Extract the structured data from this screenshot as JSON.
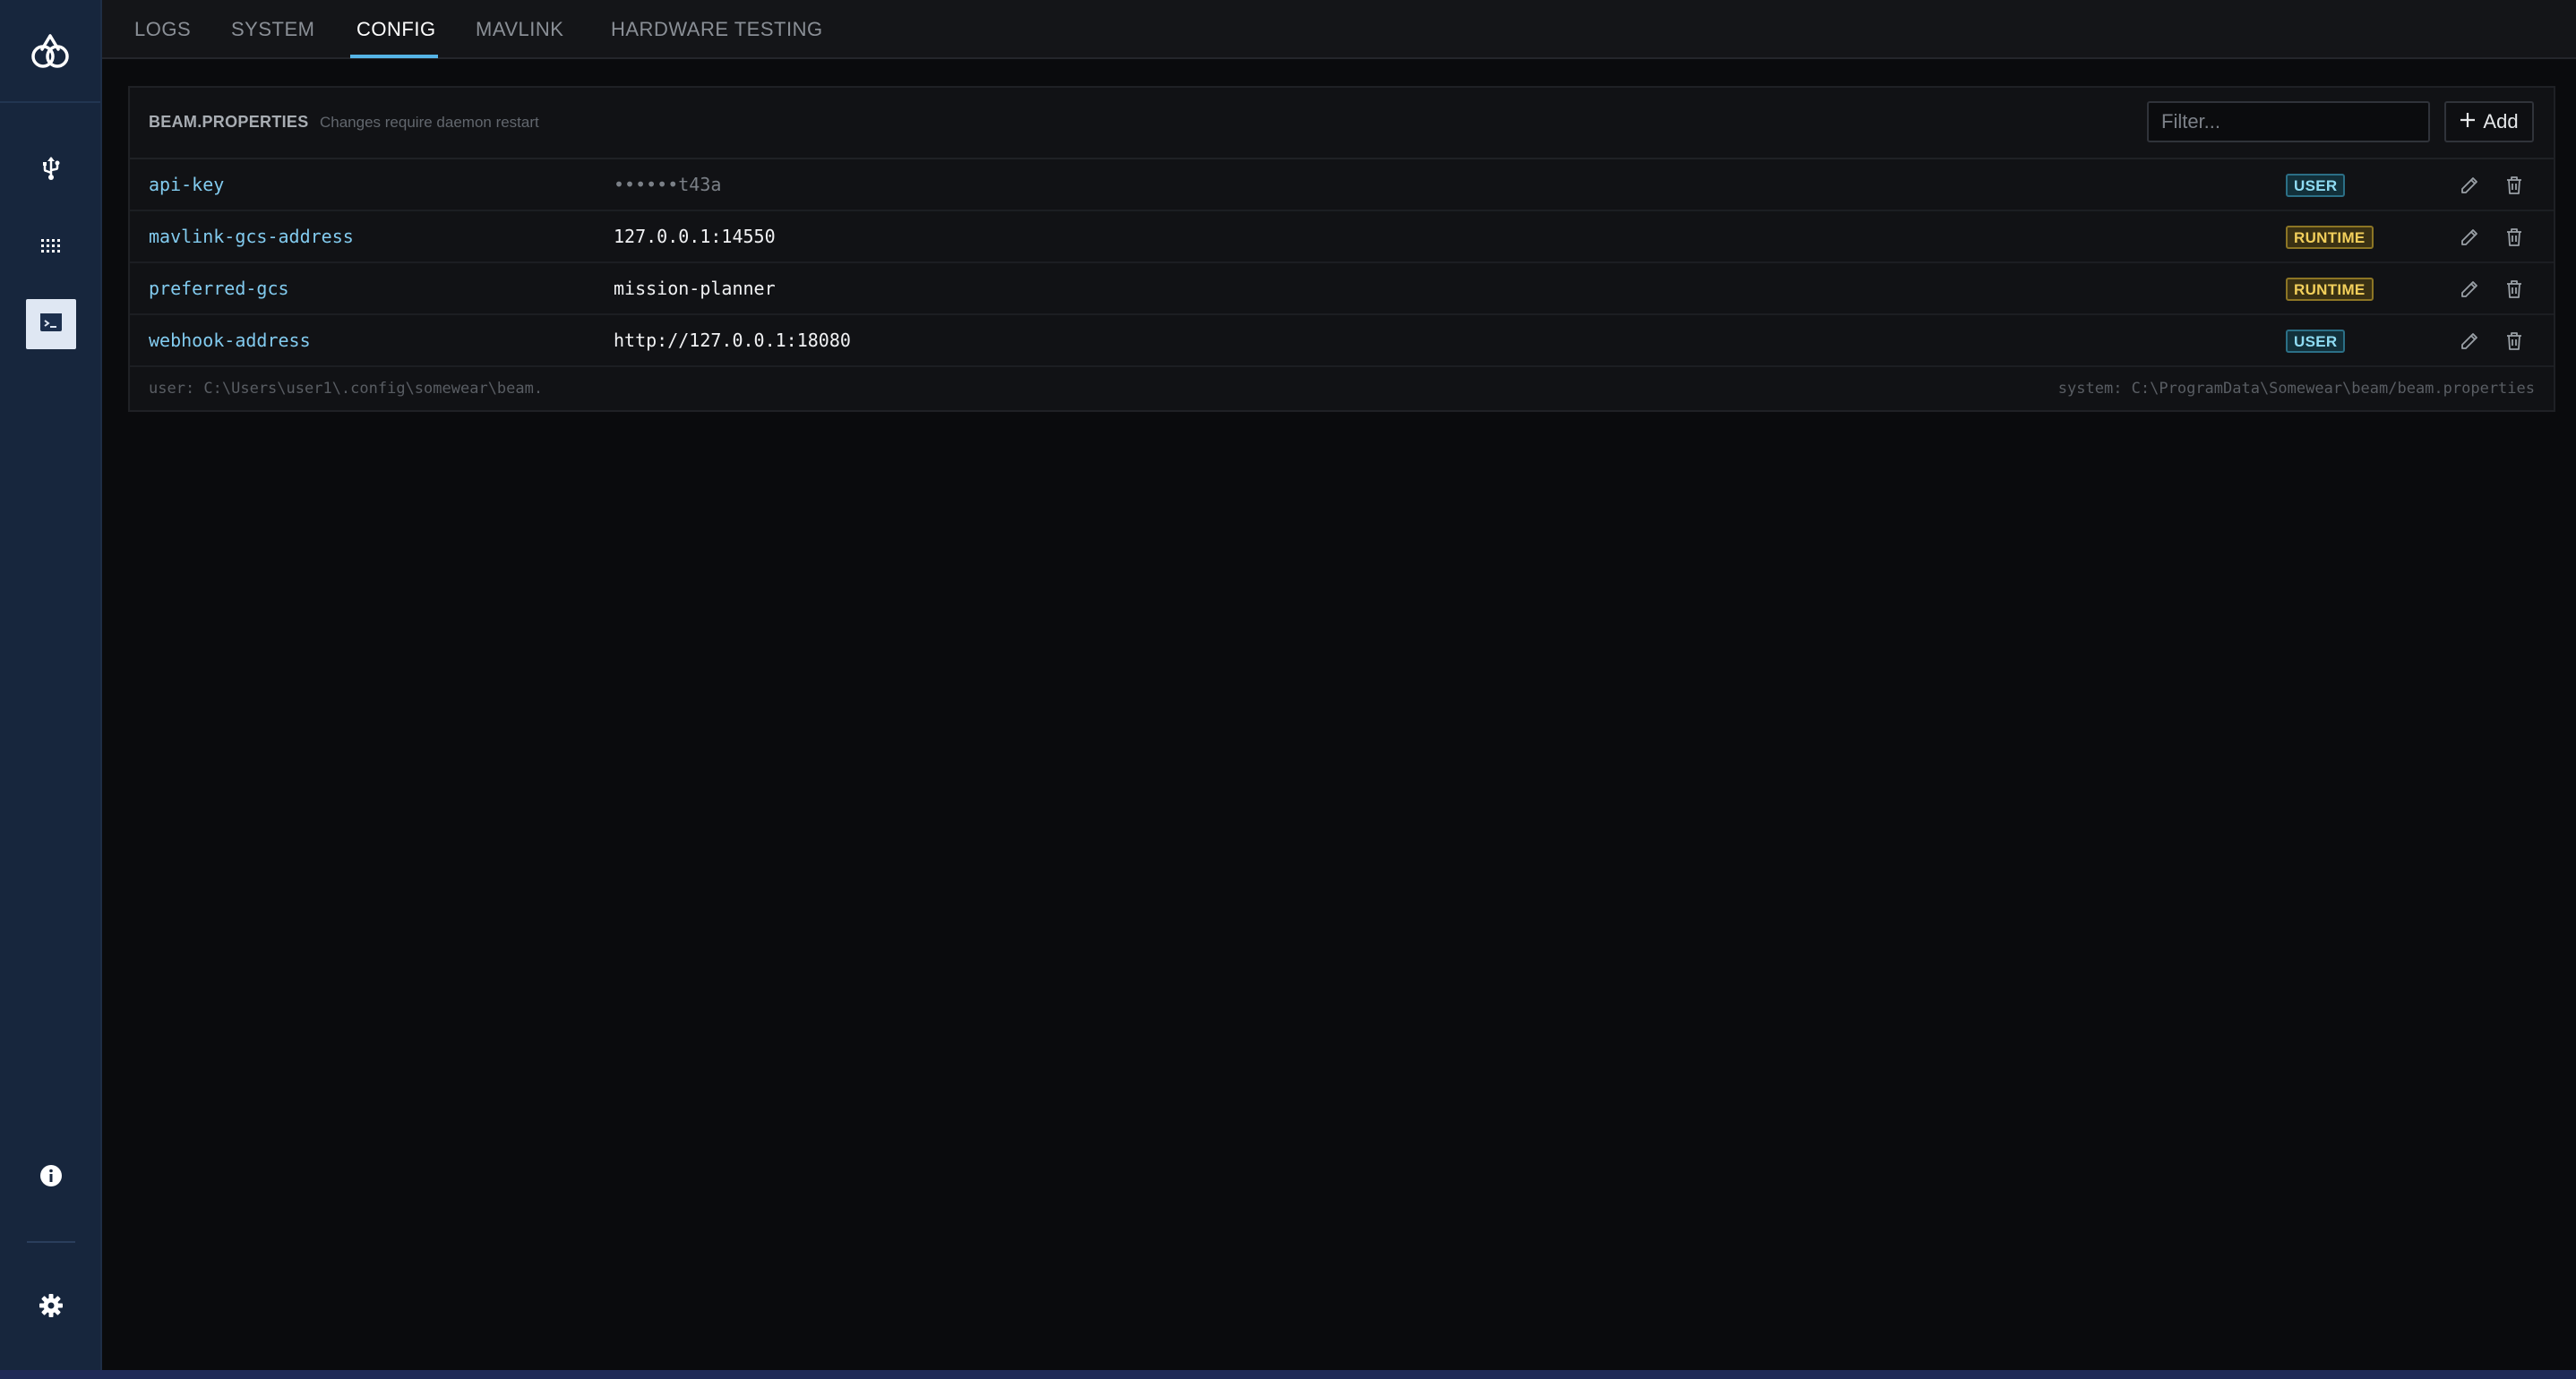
{
  "tabs": [
    {
      "label": "LOGS",
      "active": false
    },
    {
      "label": "SYSTEM",
      "active": false
    },
    {
      "label": "CONFIG",
      "active": true
    },
    {
      "label": "MAVLINK",
      "active": false
    },
    {
      "label": "HARDWARE TESTING",
      "active": false
    }
  ],
  "sidebar": {
    "logo_icon": "app-logo-icon",
    "items": [
      {
        "icon": "usb-icon",
        "active": false
      },
      {
        "icon": "grid-icon",
        "active": false
      },
      {
        "icon": "terminal-icon",
        "active": true
      }
    ],
    "bottom_items": [
      {
        "icon": "info-icon"
      },
      {
        "icon": "gear-icon"
      }
    ]
  },
  "panel": {
    "title": "BEAM.PROPERTIES",
    "subtitle": "Changes require daemon restart",
    "filter_placeholder": "Filter...",
    "add_label": "Add",
    "rows": [
      {
        "key": "api-key",
        "value": "••••••t43a",
        "scope": "USER",
        "masked": true
      },
      {
        "key": "mavlink-gcs-address",
        "value": "127.0.0.1:14550",
        "scope": "RUNTIME",
        "masked": false
      },
      {
        "key": "preferred-gcs",
        "value": "mission-planner",
        "scope": "RUNTIME",
        "masked": false
      },
      {
        "key": "webhook-address",
        "value": "http://127.0.0.1:18080",
        "scope": "USER",
        "masked": false
      }
    ],
    "footer_user": "user: C:\\Users\\user1\\.config\\somewear\\beam.",
    "footer_system": "system: C:\\ProgramData\\Somewear\\beam/beam.properties"
  },
  "colors": {
    "accent": "#56b4e6",
    "sidebar": "#17263d",
    "user_badge": "#8fdcf3",
    "runtime_badge": "#f2cf5b"
  }
}
